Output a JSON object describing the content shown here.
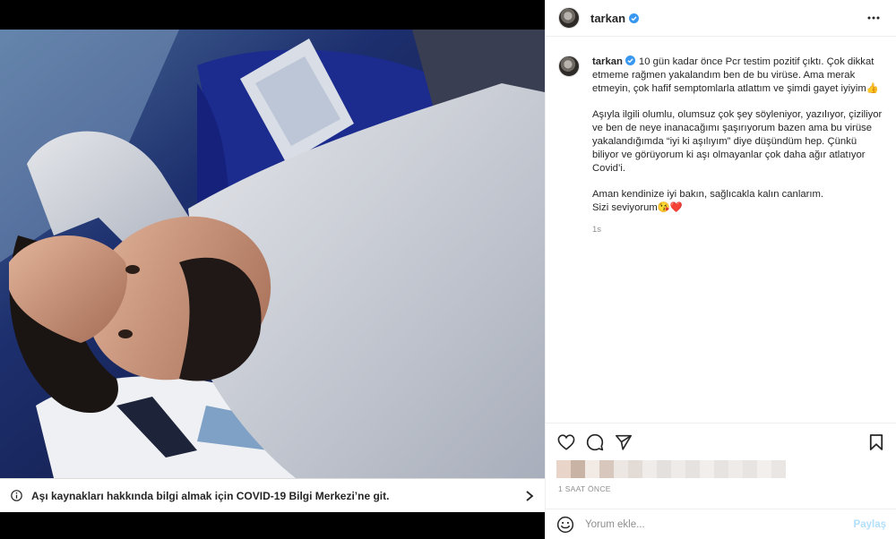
{
  "post": {
    "username": "tarkan",
    "caption": {
      "username": "tarkan",
      "paragraphs": [
        "10 gün kadar önce Pcr testim pozitif çıktı. Çok dikkat etmeme rağmen yakalandım ben de bu virüse. Ama merak etmeyin, çok hafif semptomlarla atlattım ve şimdi gayet iyiyim👍",
        "Aşıyla ilgili olumlu, olumsuz çok şey söyleniyor, yazılıyor, çiziliyor ve ben de neye inanacağımı şaşırıyorum bazen ama bu virüse yakalandığımda “iyi ki aşılıyım” diye düşündüm hep. Çünkü biliyor ve görüyorum ki aşı olmayanlar çok daha ağır atlatıyor Covid’i.",
        "Aman kendinize iyi bakın, sağlıcakla kalın canlarım.\nSizi seviyorum😘❤️"
      ],
      "time_ago": "1s"
    },
    "timestamp": "1 SAAT ÖNCE",
    "covid_banner": "Aşı kaynakları hakkında bilgi almak için COVID-19 Bilgi Merkezi’ne git."
  },
  "comment": {
    "placeholder": "Yorum ekle...",
    "share_label": "Paylaş"
  },
  "icons": {
    "more": "more-horizontal-icon",
    "like": "heart-icon",
    "comment": "comment-bubble-icon",
    "share": "paper-plane-icon",
    "save": "bookmark-icon",
    "emoji": "emoji-smile-icon",
    "info": "info-circle-icon",
    "chevron": "chevron-right-icon",
    "verified": "verified-badge-icon"
  },
  "colors": {
    "verified": "#3897f0",
    "share_disabled": "#b2dffc",
    "secondary_text": "#8e8e8e"
  }
}
